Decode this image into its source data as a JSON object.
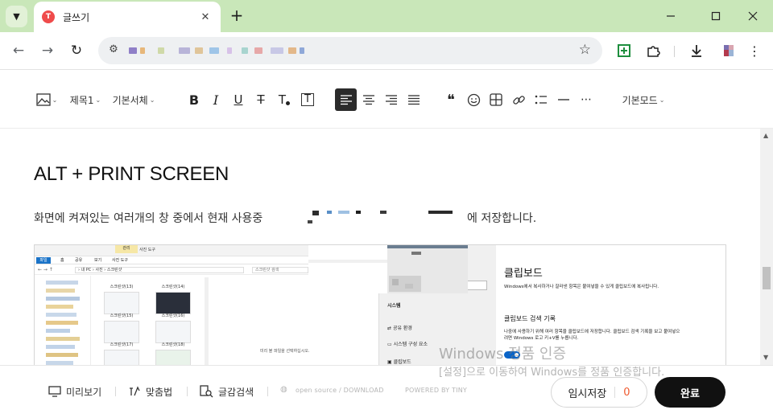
{
  "browser": {
    "tab_title": "글쓰기",
    "new_tab": "+",
    "tab_close": "✕",
    "favicon_letter": "T",
    "accent": "#c9e7b9"
  },
  "editor_toolbar": {
    "heading": "제목1",
    "font": "기본서체",
    "bold": "B",
    "italic": "I",
    "underline": "U",
    "strikethrough": "T",
    "text_color": "T",
    "text_bg": "T",
    "mode": "기본모드"
  },
  "content": {
    "heading": "ALT + PRINT SCREEN",
    "paragraph_start": "화면에 켜져있는 여러개의 창 중에서 현재 사용중",
    "paragraph_end": "에 저장합니다."
  },
  "screenshot": {
    "explorer": {
      "ribbon_manage": "관리",
      "ribbon_picture_tools": "사진 도구",
      "menu": [
        "파일",
        "홈",
        "공유",
        "보기",
        "사진 도구"
      ],
      "path": "› 내 PC › 사진 › 스크린샷",
      "search": "스크린샷 검색",
      "thumbs": [
        "스크린샷(13)",
        "스크린샷(14)",
        "스크린샷(15)",
        "스크린샷(16)",
        "스크린샷(17)",
        "스크린샷(18)"
      ],
      "empty_text": "미리 볼 파일을 선택하십시오."
    },
    "settings": {
      "section": "시스템",
      "items": [
        "공유 환경",
        "시스템 구성 요소",
        "클립보드"
      ],
      "title": "클립보드",
      "desc": "Windows에서 복사하거나 잘라낸 항목은 붙여넣을 수 있게 클립보드에 복사됩니다.",
      "sub": "클립보드 검색 기록",
      "sub_desc": "나중에 사용하기 위해 여러 항목을 클립보드에 저장합니다. 클립보드 검색 기록을 보고 붙여넣으려면 Windows 로고 키+V를 누릅니다."
    }
  },
  "bottom_bar": {
    "preview": "미리보기",
    "spelling": "맞춤법",
    "search": "글감검색",
    "opensource": "open source / DOWNLOAD",
    "powered": "POWERED BY TINY",
    "draft": "임시저장",
    "draft_count": "0",
    "done": "완료"
  },
  "watermark": {
    "line1": "Windows 정품 인증",
    "line2": "[설정]으로 이동하여 Windows를 정품 인증합니다."
  }
}
